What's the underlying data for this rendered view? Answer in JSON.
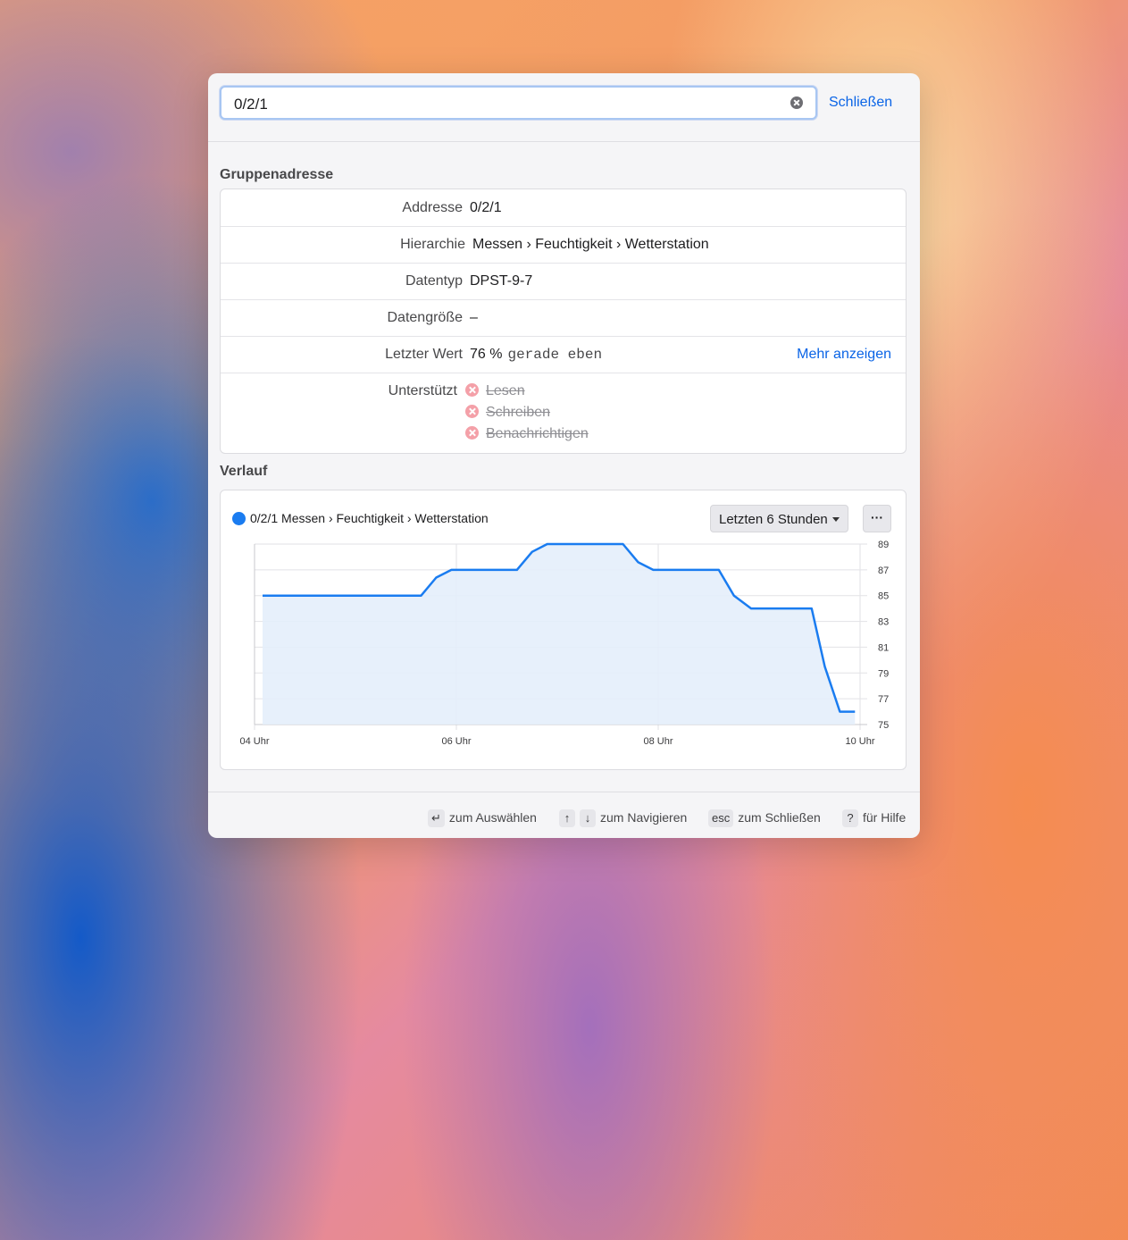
{
  "search": {
    "value": "0/2/1",
    "close_label": "Schließen"
  },
  "details": {
    "title": "Gruppenadresse",
    "rows": [
      {
        "label": "Addresse",
        "value": "0/2/1"
      },
      {
        "label": "Hierarchie",
        "value": "Messen › Feuchtigkeit › Wetterstation"
      },
      {
        "label": "Datentyp",
        "value": "DPST-9-7"
      },
      {
        "label": "Datengröße",
        "value": "–"
      }
    ],
    "last_value": {
      "label": "Letzter Wert",
      "value": "76 %",
      "time": "gerade eben",
      "more_label": "Mehr anzeigen"
    },
    "supported": {
      "label": "Unterstützt",
      "items": [
        "Lesen",
        "Schreiben",
        "Benachrichtigen"
      ]
    }
  },
  "history": {
    "title": "Verlauf",
    "legend": "0/2/1 Messen › Feuchtigkeit › Wetterstation",
    "range_label": "Letzten 6 Stunden",
    "menu_label": "···"
  },
  "chart_data": {
    "type": "area",
    "series_color": "#1a7cf0",
    "fill_color": "#e4eefb",
    "x_ticks": [
      "04 Uhr",
      "06 Uhr",
      "08 Uhr",
      "10 Uhr"
    ],
    "x_tick_hours": [
      4,
      6,
      8,
      10
    ],
    "x_range": [
      4,
      10
    ],
    "y_ticks": [
      75,
      77,
      79,
      81,
      83,
      85,
      87,
      89
    ],
    "ylim": [
      75,
      89
    ],
    "grid": true,
    "y_axis_side": "right",
    "points": [
      [
        4.08,
        85
      ],
      [
        5.5,
        85
      ],
      [
        5.65,
        85
      ],
      [
        5.8,
        86.4
      ],
      [
        5.95,
        87
      ],
      [
        6.5,
        87
      ],
      [
        6.6,
        87
      ],
      [
        6.75,
        88.4
      ],
      [
        6.9,
        89
      ],
      [
        7.5,
        89
      ],
      [
        7.65,
        89
      ],
      [
        7.8,
        87.6
      ],
      [
        7.95,
        87
      ],
      [
        8.5,
        87
      ],
      [
        8.6,
        87
      ],
      [
        8.75,
        85
      ],
      [
        8.92,
        84
      ],
      [
        9.4,
        84
      ],
      [
        9.52,
        84
      ],
      [
        9.65,
        79.5
      ],
      [
        9.8,
        76
      ],
      [
        9.95,
        76
      ]
    ]
  },
  "footer": {
    "hints": [
      {
        "keys": [
          "↵"
        ],
        "text": "zum Auswählen"
      },
      {
        "keys": [
          "↑",
          "↓"
        ],
        "text": "zum Navigieren"
      },
      {
        "keys": [
          "esc"
        ],
        "text": "zum Schließen"
      },
      {
        "keys": [
          "?"
        ],
        "text": "für Hilfe"
      }
    ]
  }
}
